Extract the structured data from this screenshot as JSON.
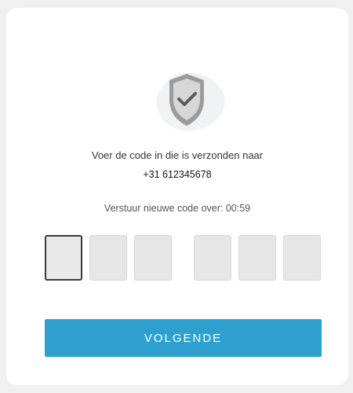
{
  "verify": {
    "message": "Voer de code in die is verzonden naar",
    "phone": "+31 612345678",
    "resend_text": "Verstuur nieuwe code over: 00:59",
    "code_digits": [
      "",
      "",
      "",
      "",
      "",
      ""
    ],
    "button_label": "VOLGENDE"
  },
  "icons": {
    "shield": "shield-check-icon"
  },
  "colors": {
    "accent": "#2ea0cf",
    "active_border": "#3b3b3b",
    "box_fill": "#e6e6e6"
  }
}
